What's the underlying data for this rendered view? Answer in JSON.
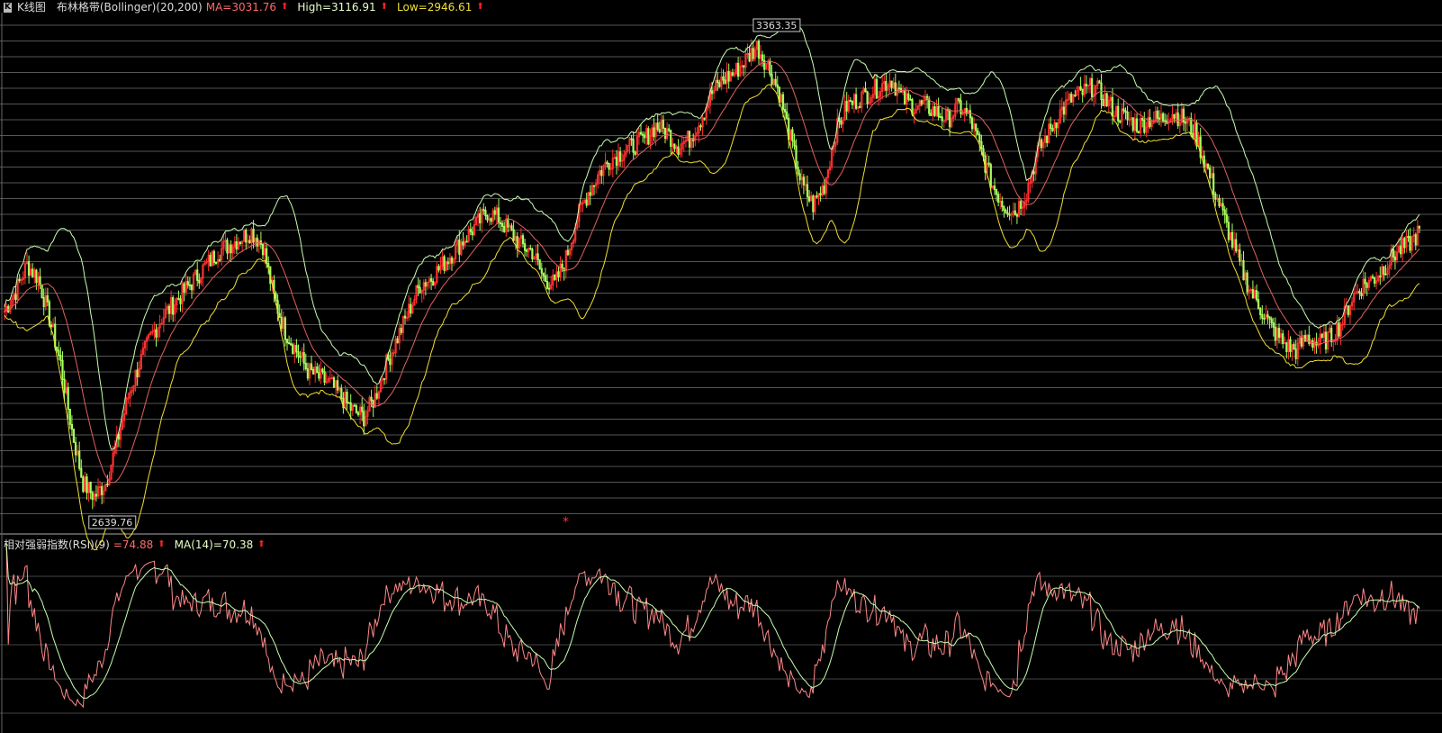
{
  "kline_header": {
    "title": "K线图",
    "indicator": "布林格带(Bollinger)(20,200)",
    "ma_label": "MA=3031.76",
    "high_label": "High=3116.91",
    "low_label": "Low=2946.61",
    "arrow": "⬆"
  },
  "rsi_header": {
    "indicator": "相对强弱指数(RSI)(9)",
    "rsi_label": "=74.88",
    "ma_label": "MA(14)=70.38",
    "arrow": "⬆"
  },
  "annotations": {
    "max_label": "3363.35",
    "min_label": "2639.76",
    "marker": "*"
  },
  "colors": {
    "up": "#ff3030",
    "down": "#a8ff60",
    "ma": "#e06060",
    "upper": "#c8ffb0",
    "lower": "#f0e030",
    "rsi": "#ff8888",
    "rsi_ma": "#c8ffb0",
    "grid": "#555"
  },
  "chart_data": [
    {
      "type": "candlestick-bollinger",
      "title": "",
      "series": [
        {
          "name": "MA",
          "latest": 3031.76
        },
        {
          "name": "High",
          "latest": 3116.91
        },
        {
          "name": "Low",
          "latest": 2946.61
        }
      ],
      "close": [
        2960,
        2990,
        3030,
        3010,
        2950,
        2880,
        2780,
        2700,
        2680,
        2700,
        2760,
        2830,
        2880,
        2920,
        2950,
        2970,
        2990,
        3010,
        3030,
        3050,
        3060,
        3070,
        3080,
        3060,
        2980,
        2930,
        2900,
        2870,
        2860,
        2850,
        2830,
        2810,
        2800,
        2830,
        2880,
        2920,
        2960,
        3000,
        3010,
        3030,
        3050,
        3070,
        3090,
        3110,
        3100,
        3080,
        3060,
        3050,
        3010,
        3000,
        3040,
        3100,
        3140,
        3170,
        3190,
        3200,
        3210,
        3220,
        3240,
        3230,
        3210,
        3220,
        3250,
        3290,
        3310,
        3320,
        3340,
        3360,
        3330,
        3290,
        3220,
        3150,
        3120,
        3150,
        3230,
        3270,
        3280,
        3290,
        3300,
        3310,
        3280,
        3270,
        3270,
        3260,
        3250,
        3270,
        3250,
        3200,
        3150,
        3120,
        3110,
        3140,
        3200,
        3230,
        3260,
        3280,
        3290,
        3300,
        3280,
        3260,
        3250,
        3240,
        3250,
        3250,
        3260,
        3250,
        3230,
        3180,
        3130,
        3080,
        3030,
        2990,
        2960,
        2930,
        2910,
        2900,
        2920,
        2910,
        2920,
        2940,
        2980,
        3000,
        3010,
        3030,
        3050,
        3060,
        3080
      ],
      "price_extremes": {
        "max": 3363.35,
        "min": 2639.76
      },
      "ylim": [
        2630,
        3400
      ]
    },
    {
      "type": "line",
      "title": "",
      "series": [
        {
          "name": "RSI(9)",
          "latest": 74.88
        },
        {
          "name": "MA(14)",
          "latest": 70.38
        }
      ],
      "ylim": [
        0,
        100
      ]
    }
  ]
}
